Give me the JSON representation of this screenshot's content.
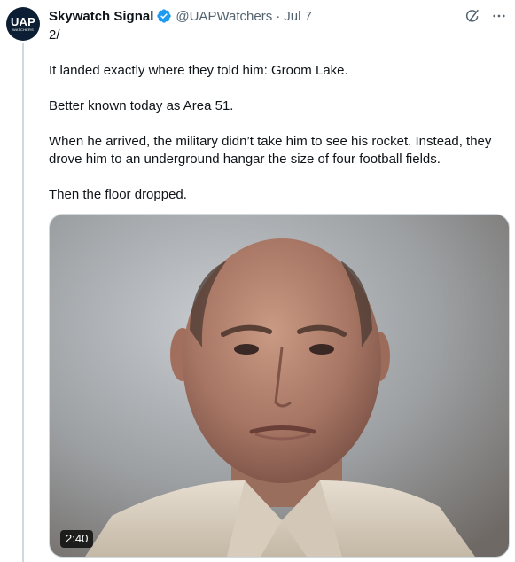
{
  "author": {
    "avatar_text": "UAP",
    "avatar_subtext": "WATCHERS",
    "display_name": "Skywatch Signal",
    "handle": "@UAPWatchers",
    "separator": "·",
    "date": "Jul 7",
    "verified": true
  },
  "actions": {
    "grok_icon": "grok-icon",
    "more_icon": "more-icon",
    "more_label": "···"
  },
  "tweet": {
    "thread_number": "2/",
    "paragraphs": [
      "It landed exactly where they told him: Groom Lake.",
      "Better known today as Area 51.",
      "When he arrived, the military didn’t take him to see his rocket. Instead, they drove him to an underground hangar the size of four football fields.",
      "Then the floor dropped."
    ]
  },
  "media": {
    "type": "video",
    "duration": "2:40"
  },
  "colors": {
    "text": "#0f1419",
    "secondary": "#536471",
    "verified": "#1d9bf0",
    "thread_line": "#cfd9de",
    "avatar_bg": "#0b1e33"
  }
}
